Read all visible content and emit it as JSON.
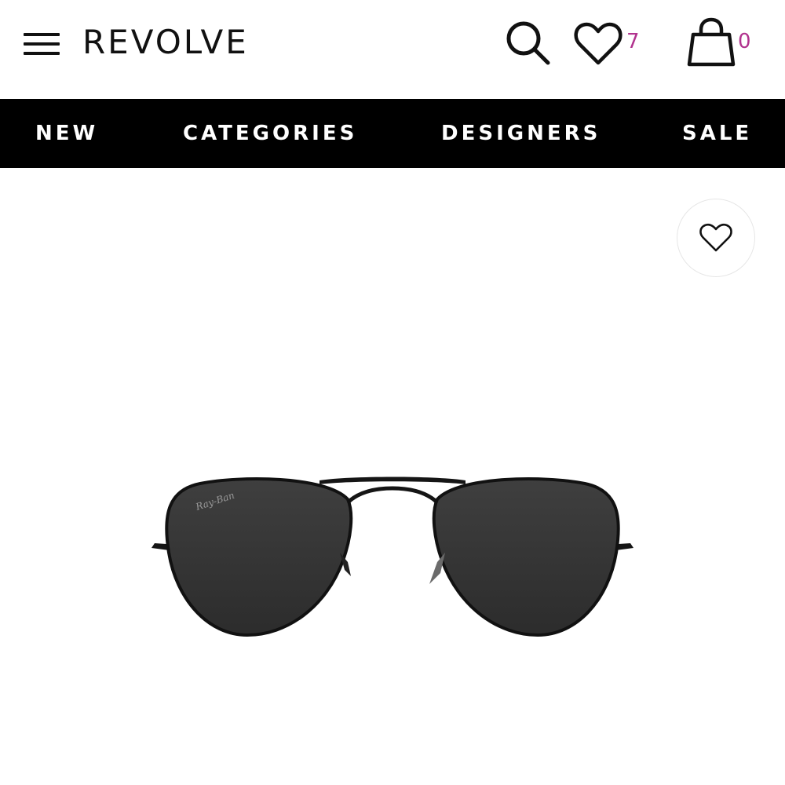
{
  "header": {
    "logo": "REVOLVE",
    "wishlist_count": "7",
    "bag_count": "0"
  },
  "nav": {
    "items": [
      "NEW",
      "CATEGORIES",
      "DESIGNERS",
      "SALE"
    ]
  },
  "product": {
    "lens_brand_mark": "Ray-Ban"
  },
  "colors": {
    "accent": "#b1338e",
    "nav_background": "#000000",
    "nav_text": "#ffffff"
  },
  "icons": [
    "menu-icon",
    "search-icon",
    "heart-icon",
    "bag-icon",
    "heart-outline-icon"
  ]
}
